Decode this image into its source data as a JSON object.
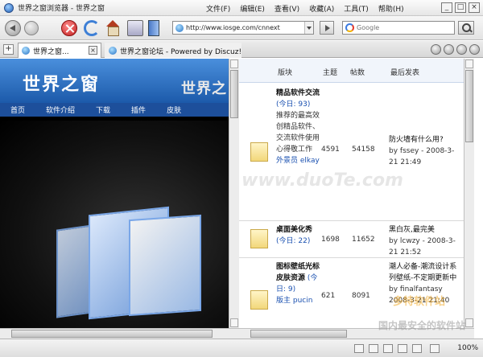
{
  "window": {
    "title": "世界之窗浏览器 - 世界之窗",
    "controls": [
      "_",
      "□",
      "×"
    ]
  },
  "menubar": {
    "items": [
      "文件(F)",
      "编辑(E)",
      "查看(V)",
      "收藏(A)",
      "工具(T)",
      "帮助(H)"
    ]
  },
  "toolbar": {
    "icons": [
      "back-icon",
      "forward-icon",
      "stop-icon",
      "refresh-icon",
      "home-icon",
      "print-icon",
      "bookmark-icon"
    ],
    "address_value": "http://www.iosge.com/cnnext",
    "search_placeholder": "Google"
  },
  "tabs": [
    {
      "label": "世界之窗..."
    },
    {
      "label": "世界之窗论坛 - Powered by Discuz!"
    }
  ],
  "left_page": {
    "logo_text": "世界之窗",
    "nav_items": [
      "首页",
      "软件介绍",
      "下载",
      "插件",
      "皮肤"
    ],
    "banner_text": "世界之"
  },
  "forum": {
    "columns": {
      "forum": "版块",
      "topics": "主题",
      "posts": "帖数",
      "last": "最后发表"
    },
    "rows": [
      {
        "name": "精品软件交流",
        "mod": "(今日: 93)",
        "desc": "推荐的最高效创精品软件、交流软件使用心得敬工作",
        "mods": "外景员 elkay",
        "topics": "4591",
        "posts": "54158",
        "last_title": "防火墙有什么用?",
        "last_by": "by fssey - 2008-3-21 21:49"
      },
      {
        "name": "桌面美化秀",
        "mod": "(今日: 22)",
        "topics": "1698",
        "posts": "11652",
        "last_title": "黑白灰,最完美",
        "last_by": "by lcwzy - 2008-3-21 21:52"
      },
      {
        "name": "图标壁纸光标皮肤资源",
        "mod": "(今日: 9)",
        "desc": "版主 pucin",
        "topics": "621",
        "posts": "8091",
        "last_title": "潮人必备-潮流设计系列壁纸-不定期更新中",
        "last_by": "by finalfantasy 2008-3-21 21:40"
      }
    ]
  },
  "statusbar": {
    "zoom": "100%"
  },
  "watermarks": {
    "center": "www.duoTe.com",
    "corner_line1": "多特软件站",
    "corner_line2": "国内最安全的软件站"
  }
}
